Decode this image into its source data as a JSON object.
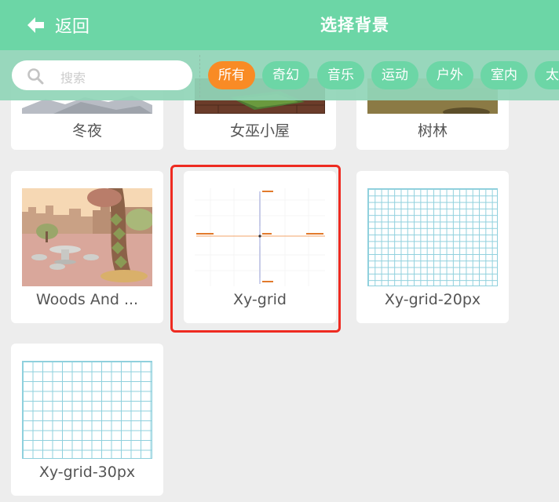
{
  "header": {
    "back_label": "返回",
    "title": "选择背景"
  },
  "search": {
    "placeholder": "搜索"
  },
  "filters": [
    "所有",
    "奇幻",
    "音乐",
    "运动",
    "户外",
    "室内",
    "太"
  ],
  "active_filter": "所有",
  "backgrounds": [
    {
      "label": "冬夜"
    },
    {
      "label": "女巫小屋"
    },
    {
      "label": "树林"
    },
    {
      "label": "Woods And ..."
    },
    {
      "label": "Xy-grid"
    },
    {
      "label": "Xy-grid-20px"
    },
    {
      "label": "Xy-grid-30px"
    }
  ],
  "selected_background": "Xy-grid",
  "colors": {
    "header": "#6cd6a6",
    "active_pill": "#f98b25",
    "pill": "#6cd6a6",
    "selection_border": "#ee2b21"
  }
}
